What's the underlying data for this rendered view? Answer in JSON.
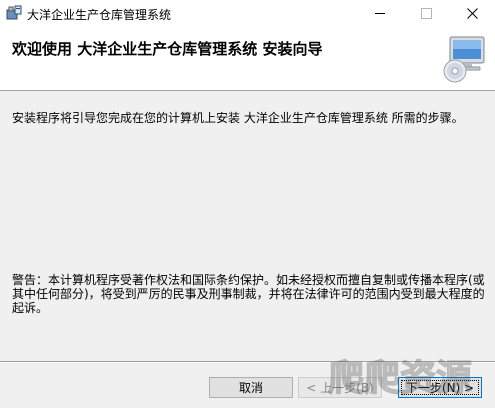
{
  "window": {
    "title": "大洋企业生产仓库管理系统",
    "controls": {
      "minimize": "minimize",
      "maximize": "maximize",
      "close": "close"
    }
  },
  "banner": {
    "title": "欢迎使用 大洋企业生产仓库管理系统 安装向导",
    "icon": "computer-cd-icon"
  },
  "content": {
    "intro": "安装程序将引导您完成在您的计算机上安装 大洋企业生产仓库管理系统 所需的步骤。",
    "warning": "警告：本计算机程序受著作权法和国际条约保护。如未经授权而擅自复制或传播本程序(或其中任何部分)，将受到严厉的民事及刑事制裁，并将在法律许可的范围内受到最大程度的起诉。"
  },
  "buttons": {
    "cancel": "取消",
    "back": "< 上一步(B)",
    "next": "下一步(N) >"
  },
  "watermark": {
    "text": "爬爬资源"
  }
}
